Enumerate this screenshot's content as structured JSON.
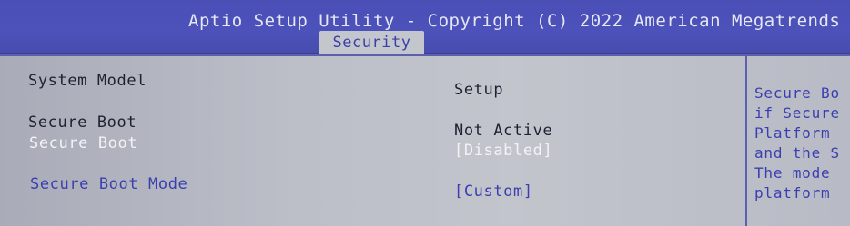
{
  "header": {
    "title": "Aptio Setup Utility - Copyright (C) 2022 American Megatrends",
    "active_tab": "Security"
  },
  "main": {
    "rows": [
      {
        "label": "System Model",
        "value": "Setup"
      },
      {
        "label": "Secure Boot",
        "value": "Not Active"
      },
      {
        "label": "Secure Boot",
        "value": "[Disabled]"
      },
      {
        "label": "Secure Boot Mode",
        "value": "[Custom]"
      }
    ]
  },
  "help": {
    "lines": [
      "Secure Bo",
      "if Secure",
      "Platform",
      "and the S",
      "The mode",
      "platform"
    ]
  },
  "colors": {
    "header_bg": "#4a4fb6",
    "panel_bg": "#c0c2cb",
    "option_blue": "#3a3fb0",
    "editable_white": "#f3f3f6"
  }
}
